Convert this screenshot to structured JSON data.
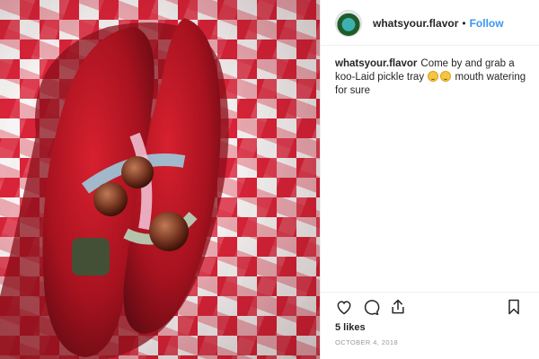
{
  "header": {
    "username": "whatsyour.flavor",
    "separator": "•",
    "follow_label": "Follow"
  },
  "caption": {
    "username": "whatsyour.flavor",
    "text": "Come by and grab a koo-Laid pickle tray",
    "text_after": "mouth watering for sure"
  },
  "actions": {
    "icons": [
      "heart-icon",
      "comment-icon",
      "share-icon",
      "bookmark-icon"
    ]
  },
  "stats": {
    "likes": "5 likes",
    "date": "OCTOBER 4, 2018"
  },
  "colors": {
    "link": "#3897f0",
    "checker_red": "#d92338",
    "pickle": "#a8121f"
  }
}
